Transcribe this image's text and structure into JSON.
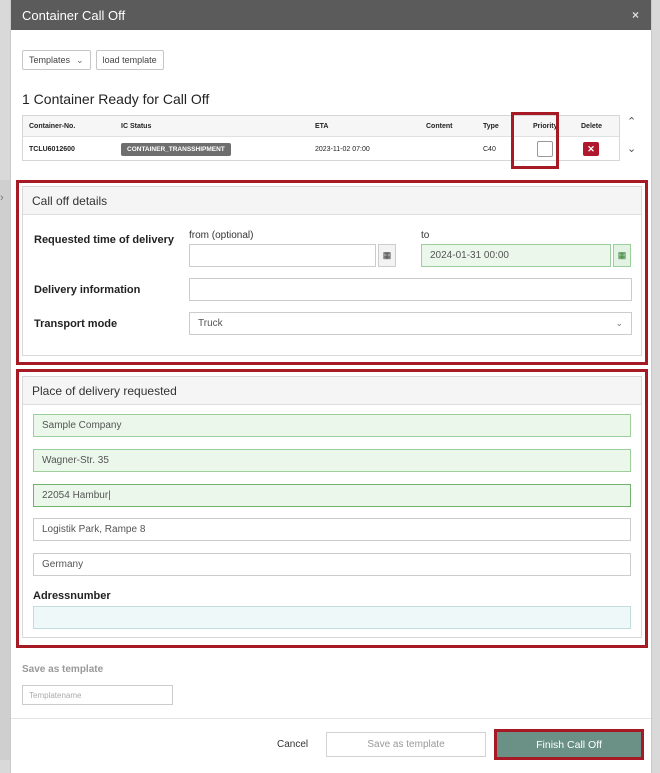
{
  "window": {
    "title": "Container Call Off",
    "close_glyph": "×"
  },
  "toolbar": {
    "templates_label": "Templates",
    "load_label": "load template"
  },
  "ready_title": "1 Container Ready for Call Off",
  "container_table": {
    "headers": [
      "Container-No.",
      "IC Status",
      "ETA",
      "Content",
      "Type",
      "Priority",
      "Delete"
    ],
    "row": {
      "container_no": "TCLU6012600",
      "status": "CONTAINER_TRANSSHIPMENT",
      "eta": "2023-11-02 07:00",
      "content": "",
      "type": "C40"
    }
  },
  "call_off": {
    "header": "Call off details",
    "requested_time_label": "Requested time of delivery",
    "from_label": "from (optional)",
    "from_value": "",
    "to_label": "to",
    "to_value": "2024-01-31 00:00",
    "delivery_info_label": "Delivery information",
    "delivery_info_value": "",
    "transport_mode_label": "Transport mode",
    "transport_mode_value": "Truck"
  },
  "delivery_place": {
    "header": "Place of delivery requested",
    "company": "Sample Company",
    "street": "Wagner-Str. 35",
    "city": "22054 Hambur",
    "extra": "Logistik Park, Rampe 8",
    "country": "Germany",
    "adressnumber_label": "Adressnumber",
    "adressnumber_value": ""
  },
  "template": {
    "label": "Save as template",
    "placeholder": "Templatename"
  },
  "footer": {
    "cancel": "Cancel",
    "save_template": "Save as template",
    "finish": "Finish Call Off"
  },
  "icons": {
    "calendar": "calendar-icon",
    "delete": "delete-icon",
    "chevron": "chevron-down-icon"
  },
  "colors": {
    "titlebar": "#5b5b5b",
    "highlight": "#a61a26",
    "finish": "#6b9186",
    "delete": "#b0182d"
  }
}
